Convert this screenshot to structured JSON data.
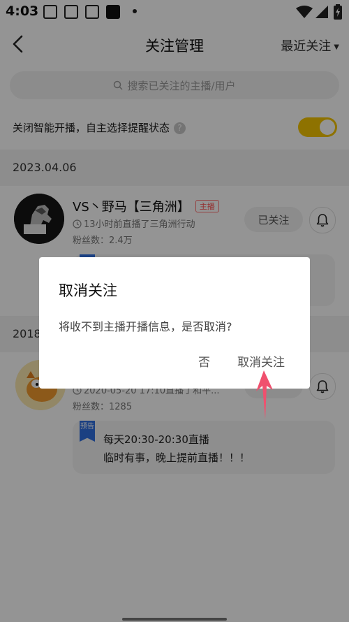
{
  "status_bar": {
    "time": "4:03"
  },
  "nav": {
    "title": "关注管理",
    "sort_label": "最近关注"
  },
  "search": {
    "placeholder": "搜索已关注的主播/用户"
  },
  "smart": {
    "label": "关闭智能开播，自主选择提醒状态",
    "help": "?",
    "toggle_on": true
  },
  "sections": [
    {
      "date": "2023.04.06"
    },
    {
      "date": "2018"
    }
  ],
  "users": [
    {
      "name": "VS丶野马【三角洲】",
      "badge": "主播",
      "live_text": "13小时前直播了三角洲行动",
      "fans": "粉丝数：2.4万",
      "follow_label": "已关注"
    },
    {
      "live_text": "2020-05-20 17:10直播了和平...",
      "fans": "粉丝数：1285",
      "notice_tag": "预告",
      "notice_line1": "每天20:30-20:30直播",
      "notice_line2": "临时有事，晚上提前直播！！！"
    }
  ],
  "dialog": {
    "title": "取消关注",
    "message": "将收不到主播开播信息，是否取消?",
    "cancel_label": "否",
    "confirm_label": "取消关注"
  },
  "colors": {
    "accent_yellow": "#f5c400",
    "badge_red": "#ff5050",
    "arrow_red": "#f0506e",
    "notice_blue": "#2f6fe0"
  }
}
